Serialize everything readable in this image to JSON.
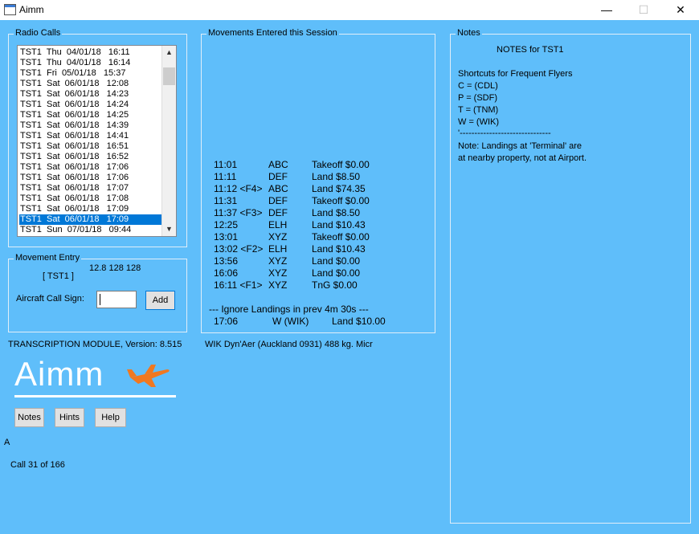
{
  "window": {
    "title": "Aimm"
  },
  "radio_calls": {
    "legend": "Radio Calls",
    "items": [
      "TST1  Thu  04/01/18   16:11",
      "TST1  Thu  04/01/18   16:14",
      "TST1  Fri  05/01/18   15:37",
      "TST1  Sat  06/01/18   12:08",
      "TST1  Sat  06/01/18   14:23",
      "TST1  Sat  06/01/18   14:24",
      "TST1  Sat  06/01/18   14:25",
      "TST1  Sat  06/01/18   14:39",
      "TST1  Sat  06/01/18   14:41",
      "TST1  Sat  06/01/18   16:51",
      "TST1  Sat  06/01/18   16:52",
      "TST1  Sat  06/01/18   17:06",
      "TST1  Sat  06/01/18   17:06",
      "TST1  Sat  06/01/18   17:07",
      "TST1  Sat  06/01/18   17:08",
      "TST1  Sat  06/01/18   17:09",
      "TST1  Sat  06/01/18   17:09",
      "TST1  Sun  07/01/18   09:44"
    ],
    "selected_index": 16
  },
  "movement_entry": {
    "legend": "Movement Entry",
    "values": "12.8    128    128",
    "callsign_tag": "[ TST1 ]",
    "aircraft_label": "Aircraft Call Sign:",
    "aircraft_value": "",
    "add_label": "Add"
  },
  "movements": {
    "legend": "Movements Entered this Session",
    "rows": [
      {
        "time": "11:01",
        "code": "ABC",
        "action": "Takeoff $0.00"
      },
      {
        "time": "11:11",
        "code": "DEF",
        "action": "Land $8.50"
      },
      {
        "time": "11:12 <F4>",
        "code": "ABC",
        "action": "Land $74.35"
      },
      {
        "time": "11:31",
        "code": "DEF",
        "action": "Takeoff $0.00"
      },
      {
        "time": "11:37 <F3>",
        "code": "DEF",
        "action": "Land $8.50"
      },
      {
        "time": "12:25",
        "code": "ELH",
        "action": "Land $10.43"
      },
      {
        "time": "13:01",
        "code": "XYZ",
        "action": "Takeoff $0.00"
      },
      {
        "time": "13:02 <F2>",
        "code": "ELH",
        "action": "Land $10.43"
      },
      {
        "time": "13:56",
        "code": "XYZ",
        "action": "Land $0.00"
      },
      {
        "time": "16:06",
        "code": "XYZ",
        "action": "Land $0.00"
      },
      {
        "time": "16:11 <F1>",
        "code": "XYZ",
        "action": "TnG $0.00"
      }
    ],
    "ignore_note": "--- Ignore Landings in prev 4m 30s ---",
    "ignored": {
      "time": "17:06",
      "code": "W (WIK)",
      "action": "Land $10.00"
    }
  },
  "notes": {
    "legend": "Notes",
    "title": "NOTES for TST1",
    "lines": [
      "Shortcuts for Frequent Flyers",
      "C = (CDL)",
      "P = (SDF)",
      "T = (TNM)",
      "W = (WIK)",
      "'-------------------------------",
      "Note:  Landings at 'Terminal' are",
      "at nearby property, not at Airport."
    ]
  },
  "status": {
    "module": "TRANSCRIPTION MODULE,  Version: 8.515",
    "info": "WIK  Dyn'Aer   (Auckland 0931)  488 kg.  Micr",
    "letter": "A",
    "call_count": "Call 31 of 166"
  },
  "buttons": {
    "notes": "Notes",
    "hints": "Hints",
    "help": "Help"
  },
  "logo": {
    "text": "Aimm",
    "color": "#ffffff",
    "plane_color": "#f07820"
  },
  "colors": {
    "background": "#5fbefa",
    "selection": "#0078d7"
  }
}
